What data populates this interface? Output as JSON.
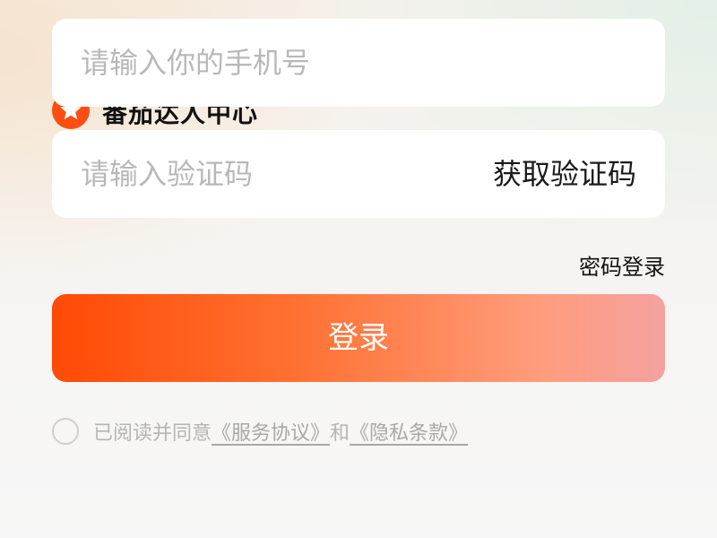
{
  "brand": {
    "name": "番茄达人中心",
    "logo_icon": "star-icon",
    "accent_color": "#ff4e12"
  },
  "phone_input": {
    "placeholder": "请输入你的手机号",
    "value": ""
  },
  "code_input": {
    "placeholder": "请输入验证码",
    "value": "",
    "get_code_label": "获取验证码"
  },
  "password_login_label": "密码登录",
  "login_button": {
    "label": "登录",
    "gradient_start": "#ff4a05",
    "gradient_end": "#f4a1a0"
  },
  "agreement": {
    "checked": false,
    "prefix": "已阅读并同意",
    "service_link": "《服务协议》",
    "conjunction": "和",
    "privacy_link": "《隐私条款》"
  }
}
